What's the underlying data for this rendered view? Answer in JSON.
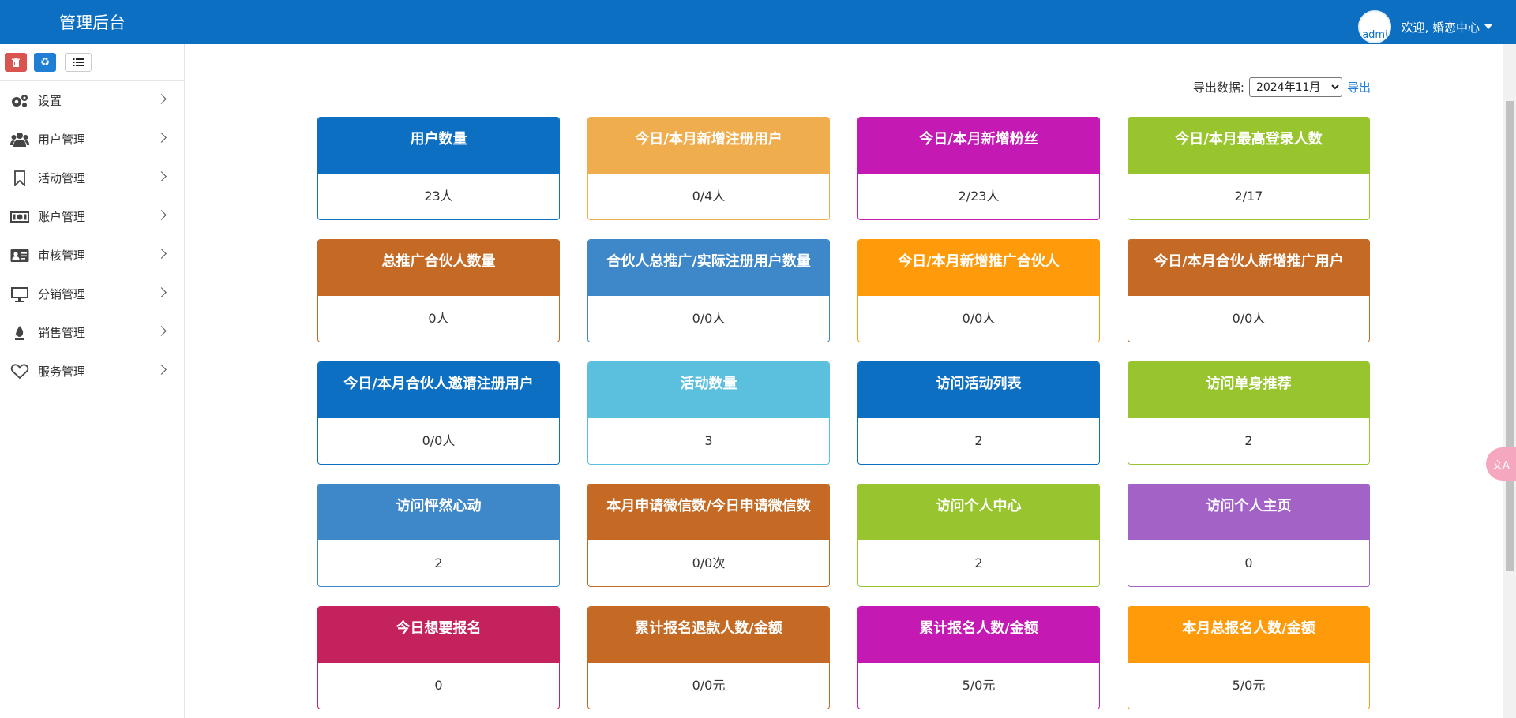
{
  "header": {
    "title": "管理后台",
    "avatar_text": "admi",
    "welcome": "欢迎, 婚恋中心"
  },
  "toolbar": {
    "delete_icon": "trash-icon",
    "refresh_icon": "recycle-icon",
    "list_icon": "list-icon"
  },
  "sidebar": {
    "items": [
      {
        "label": "设置",
        "icon": "gears-icon"
      },
      {
        "label": "用户管理",
        "icon": "users-icon"
      },
      {
        "label": "活动管理",
        "icon": "bookmark-icon"
      },
      {
        "label": "账户管理",
        "icon": "money-icon"
      },
      {
        "label": "审核管理",
        "icon": "id-card-icon"
      },
      {
        "label": "分销管理",
        "icon": "desktop-icon"
      },
      {
        "label": "销售管理",
        "icon": "fire-icon"
      },
      {
        "label": "服务管理",
        "icon": "heart-icon"
      }
    ]
  },
  "export": {
    "label": "导出数据:",
    "selected_month": "2024年11月",
    "link": "导出"
  },
  "cards": [
    {
      "title": "用户数量",
      "value": "23人",
      "color": "#0d6fc2"
    },
    {
      "title": "今日/本月新增注册用户",
      "value": "0/4人",
      "color": "#f0ad4e"
    },
    {
      "title": "今日/本月新增粉丝",
      "value": "2/23人",
      "color": "#c41ab3"
    },
    {
      "title": "今日/本月最高登录人数",
      "value": "2/17",
      "color": "#98c52d"
    },
    {
      "title": "总推广合伙人数量",
      "value": "0人",
      "color": "#c46a25"
    },
    {
      "title": "合伙人总推广/实际注册用户数量",
      "value": "0/0人",
      "color": "#3e87c9"
    },
    {
      "title": "今日/本月新增推广合伙人",
      "value": "0/0人",
      "color": "#ff9a0a"
    },
    {
      "title": "今日/本月合伙人新增推广用户",
      "value": "0/0人",
      "color": "#c46a25"
    },
    {
      "title": "今日/本月合伙人邀请注册用户",
      "value": "0/0人",
      "color": "#0d6fc2"
    },
    {
      "title": "活动数量",
      "value": "3",
      "color": "#5bc0de"
    },
    {
      "title": "访问活动列表",
      "value": "2",
      "color": "#0d6fc2"
    },
    {
      "title": "访问单身推荐",
      "value": "2",
      "color": "#98c52d"
    },
    {
      "title": "访问怦然心动",
      "value": "2",
      "color": "#3e87c9"
    },
    {
      "title": "本月申请微信数/今日申请微信数",
      "value": "0/0次",
      "color": "#c46a25"
    },
    {
      "title": "访问个人中心",
      "value": "2",
      "color": "#98c52d"
    },
    {
      "title": "访问个人主页",
      "value": "0",
      "color": "#a362c6"
    },
    {
      "title": "今日想要报名",
      "value": "0",
      "color": "#c4225c"
    },
    {
      "title": "累计报名退款人数/金额",
      "value": "0/0元",
      "color": "#c46a25"
    },
    {
      "title": "累计报名人数/金额",
      "value": "5/0元",
      "color": "#c41ab3"
    },
    {
      "title": "本月总报名人数/金额",
      "value": "5/0元",
      "color": "#ff9a0a"
    }
  ],
  "translate_icon": "translate-icon"
}
